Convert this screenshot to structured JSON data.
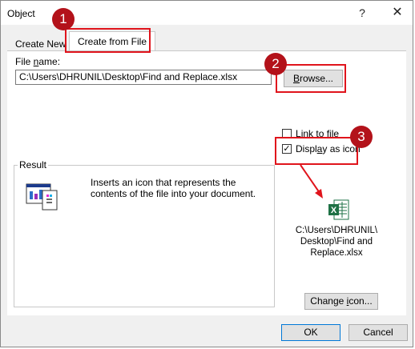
{
  "window": {
    "title": "Object",
    "help_glyph": "?",
    "close_glyph": "✕"
  },
  "tabs": [
    {
      "label": "Create New"
    },
    {
      "label": "Create from File"
    }
  ],
  "file": {
    "label_prefix": "File ",
    "label_underlined": "n",
    "label_suffix": "ame:",
    "value": "C:\\Users\\DHRUNIL\\Desktop\\Find and Replace.xlsx"
  },
  "browse": {
    "underlined": "B",
    "rest": "rowse..."
  },
  "options": {
    "link": {
      "underlined": "L",
      "rest": "ink to file",
      "checked": false
    },
    "display": {
      "prefix": "Displ",
      "underlined": "a",
      "suffix": "y as icon",
      "checked": true,
      "check_glyph": "✓"
    }
  },
  "result": {
    "legend": "Result",
    "text": "Inserts an icon that represents the contents of the file into your document."
  },
  "icon_preview": {
    "caption_lines": [
      "C:\\Users\\DHRUNIL\\",
      "Desktop\\Find and",
      "Replace.xlsx"
    ],
    "excel_letter": "X"
  },
  "change_icon": {
    "prefix": "Change ",
    "underlined": "i",
    "suffix": "con..."
  },
  "buttons": {
    "ok": "OK",
    "cancel": "Cancel"
  },
  "annotations": [
    {
      "number": "1"
    },
    {
      "number": "2"
    },
    {
      "number": "3"
    }
  ],
  "colors": {
    "annotation_red": "#e0141c",
    "badge_fill": "#b3121a",
    "excel_green": "#1e7145"
  }
}
